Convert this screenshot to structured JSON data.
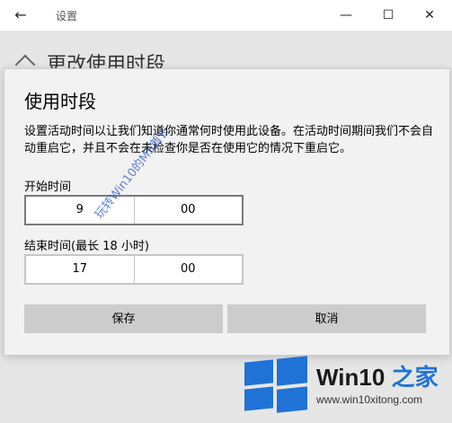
{
  "window": {
    "title": "设置",
    "back_icon": "←",
    "minimize_icon": "—",
    "maximize_icon": "☐",
    "close_icon": "✕"
  },
  "background_page": {
    "heading": "更改使用时段"
  },
  "dialog": {
    "title": "使用时段",
    "description": "设置活动时间以让我们知道你通常何时使用此设备。在活动时间期间我们不会自动重启它，并且不会在未检查你是否在使用它的情况下重启它。",
    "start_label": "开始时间",
    "start_hour": "9",
    "start_minute": "00",
    "end_label": "结束时间(最长 18 小时)",
    "end_hour": "17",
    "end_minute": "00",
    "save_label": "保存",
    "cancel_label": "取消"
  },
  "watermark": "玩转Win10的MS酋长",
  "logo": {
    "brand_main": "Win10",
    "brand_accent": "之家",
    "url": "www.win10xitong.com",
    "color": "#1f73d6"
  }
}
